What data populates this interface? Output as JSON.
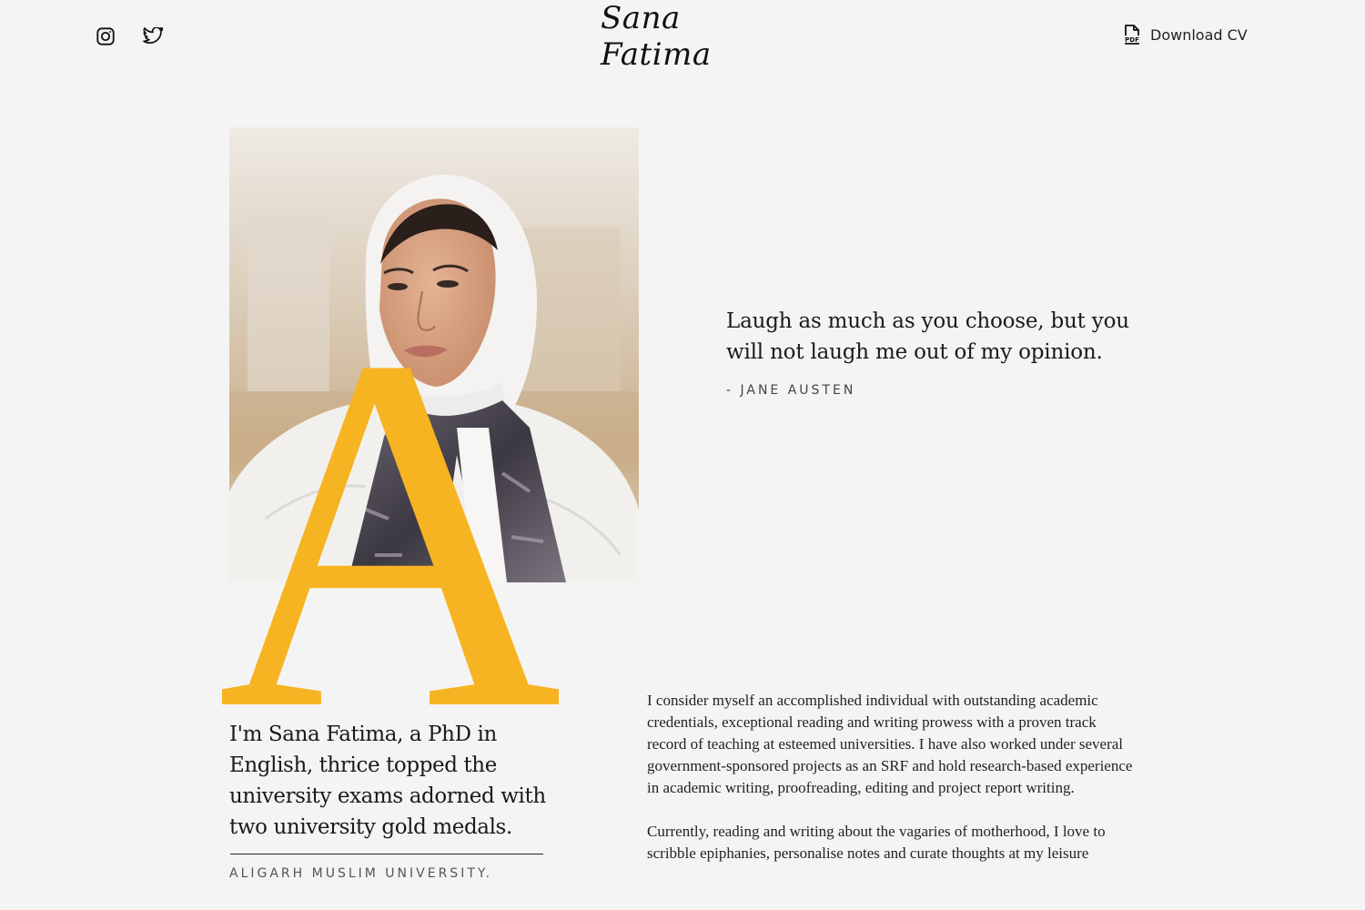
{
  "header": {
    "logo_text": "Sana Fatima",
    "social": [
      {
        "icon": "instagram-icon"
      },
      {
        "icon": "twitter-icon"
      }
    ],
    "download": {
      "icon": "pdf-file-icon",
      "icon_text": "PDF",
      "label": "Download CV"
    }
  },
  "hero": {
    "dropcap": "A",
    "dropcap_color": "#F7B422",
    "quote": "Laugh as much as you choose, but you will not laugh me out of my opinion.",
    "quote_author": "- JANE AUSTEN"
  },
  "intro": {
    "text": "I'm Sana Fatima, a PhD in English, thrice topped the university exams adorned with two university gold medals.",
    "university": "ALIGARH MUSLIM UNIVERSITY."
  },
  "bio": {
    "paragraph_1": "I consider myself an accomplished individual with outstanding academic credentials, exceptional reading and writing prowess with a proven track record of teaching at esteemed universities. I have also worked under several government-sponsored projects as an SRF and hold research-based experience in academic writing, proofreading, editing and project report writing.",
    "paragraph_2": "Currently, reading and writing about the vagaries of motherhood, I love to scribble epiphanies, personalise notes and curate thoughts at my leisure"
  },
  "colors": {
    "background": "#F4F4F4",
    "accent": "#F7B422",
    "text": "#1C1C1C"
  }
}
